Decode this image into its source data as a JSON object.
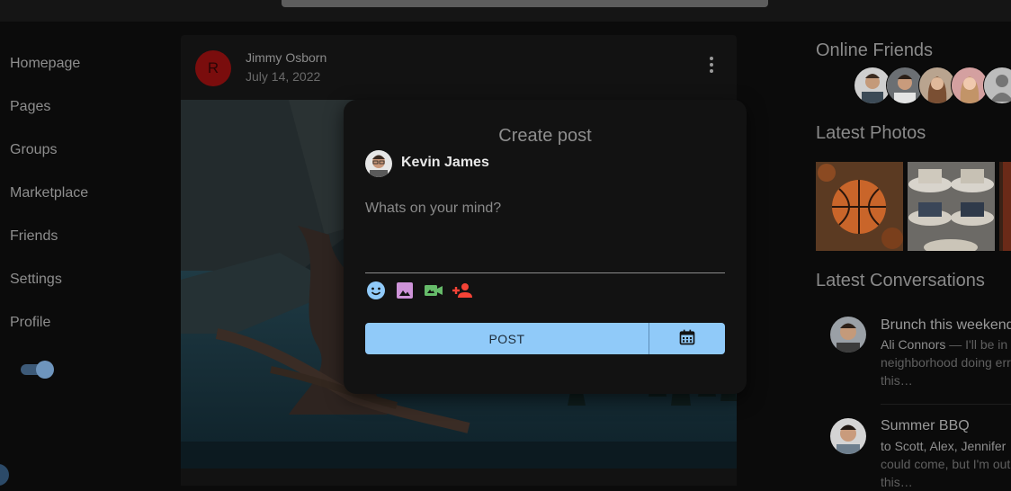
{
  "nav": {
    "items": [
      "Homepage",
      "Pages",
      "Groups",
      "Marketplace",
      "Friends",
      "Settings",
      "Profile"
    ]
  },
  "post": {
    "avatar_letter": "R",
    "author": "Jimmy Osborn",
    "date": "July 14, 2022"
  },
  "modal": {
    "title": "Create post",
    "user": "Kevin James",
    "placeholder": "Whats on your mind?",
    "post_label": "POST",
    "tools": [
      "emoji-icon",
      "image-icon",
      "video-icon",
      "tag-person-icon"
    ]
  },
  "right": {
    "online_friends_title": "Online Friends",
    "latest_photos_title": "Latest Photos",
    "latest_conversations_title": "Latest Conversations",
    "conversations": [
      {
        "title": "Brunch this weekend",
        "sender": "Ali Connors",
        "line1_rest": " — I'll be in your",
        "line2": "neighborhood doing errands",
        "line3": "this…"
      },
      {
        "title": "Summer BBQ",
        "sender": "to Scott, Alex, Jennifer",
        "line1_rest": "",
        "line2": "could come, but I'm out of town",
        "line3": "this…"
      }
    ]
  },
  "colors": {
    "accent": "#90caf9",
    "background": "#0b0b0b",
    "card": "#121212"
  }
}
